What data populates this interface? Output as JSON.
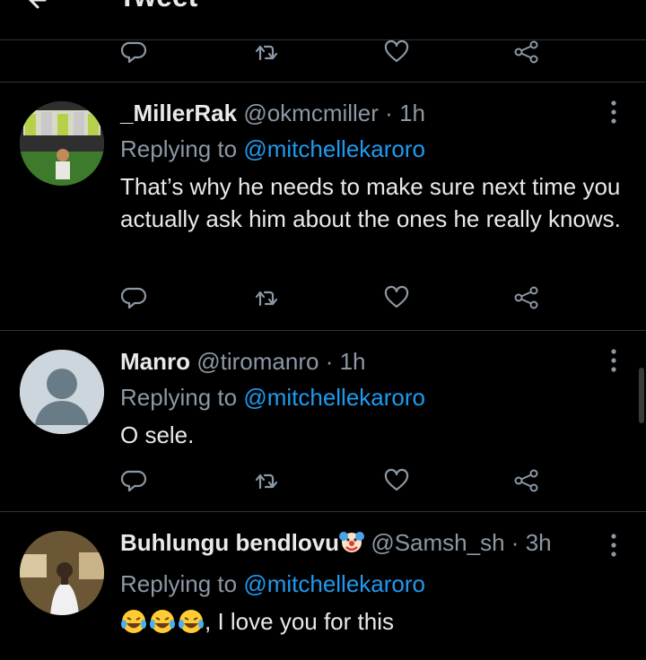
{
  "header": {
    "title": "Tweet"
  },
  "tweets": [
    {
      "name": "_MillerRak",
      "handle": "@okmcmiller",
      "dot": "·",
      "time": "1h",
      "replying_label": "Replying to",
      "replying_user": "@mitchellekaroro",
      "text": "That’s why he needs to make sure next time you actually ask him about the ones he really knows."
    },
    {
      "name": "Manro",
      "handle": "@tiromanro",
      "dot": "·",
      "time": "1h",
      "replying_label": "Replying to",
      "replying_user": "@mitchellekaroro",
      "text": "O sele."
    },
    {
      "name": "Buhlungu bendlovu",
      "handle": "@Samsh_sh",
      "dot": "·",
      "time": "3h",
      "replying_label": "Replying to",
      "replying_user": "@mitchellekaroro",
      "text": ", I love you for this"
    }
  ],
  "icons": {
    "reply": "reply-icon",
    "retweet": "retweet-icon",
    "like": "like-icon",
    "share": "share-icon",
    "more": "more-icon"
  },
  "colors": {
    "background": "#000000",
    "primary_text": "#e7e9ea",
    "secondary_text": "#8b98a5",
    "link": "#1d9bf0",
    "divider": "#2f3336"
  }
}
